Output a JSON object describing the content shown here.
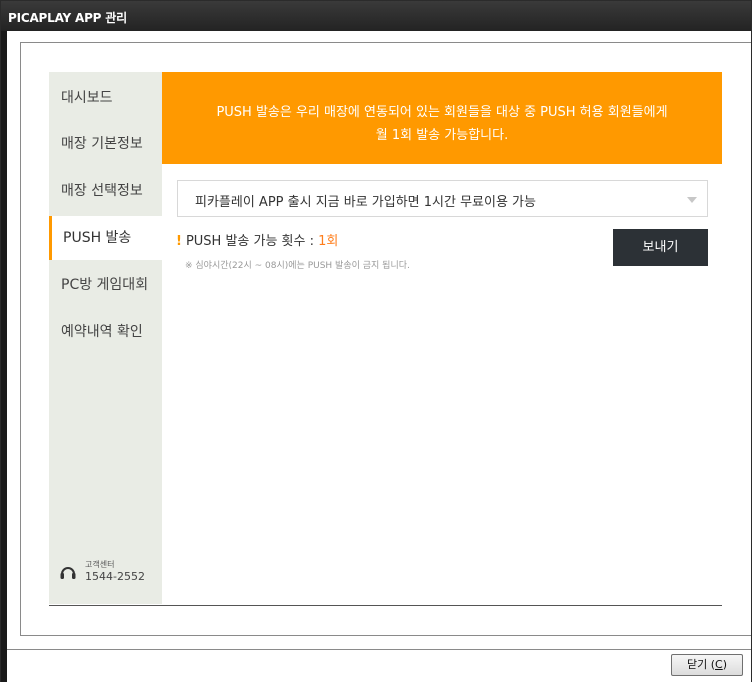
{
  "window": {
    "title": "PICAPLAY APP 관리"
  },
  "sidebar": {
    "items": [
      {
        "label": "대시보드",
        "active": false
      },
      {
        "label": "매장 기본정보",
        "active": false
      },
      {
        "label": "매장 선택정보",
        "active": false
      },
      {
        "label": "PUSH 발송",
        "active": true
      },
      {
        "label": "PC방 게임대회",
        "active": false
      },
      {
        "label": "예약내역 확인",
        "active": false
      }
    ],
    "support": {
      "label": "고객센터",
      "phone": "1544-2552",
      "icon": "headset-icon"
    }
  },
  "banner": {
    "line1": "PUSH 발송은 우리 매장에 연동되어 있는 회원들을 대상 중 PUSH 허용 회원들에게",
    "line2": "월 1회 발송 가능합니다."
  },
  "push": {
    "selected_message": "피카플레이 APP 출시 지금 바로 가입하면 1시간 무료이용 가능",
    "count_label": "PUSH 발송 가능 횟수 : ",
    "count_value": "1회",
    "notice": "※ 심야시간(22시 ~ 08시)에는 PUSH 발송이 금지 됩니다.",
    "send_label": "보내기"
  },
  "footer": {
    "close_label": "닫기 (",
    "close_key": "C",
    "close_end": ")"
  },
  "colors": {
    "accent": "#ff9900",
    "sidebar_bg": "#e9ece5",
    "button_dark": "#2c3136"
  }
}
